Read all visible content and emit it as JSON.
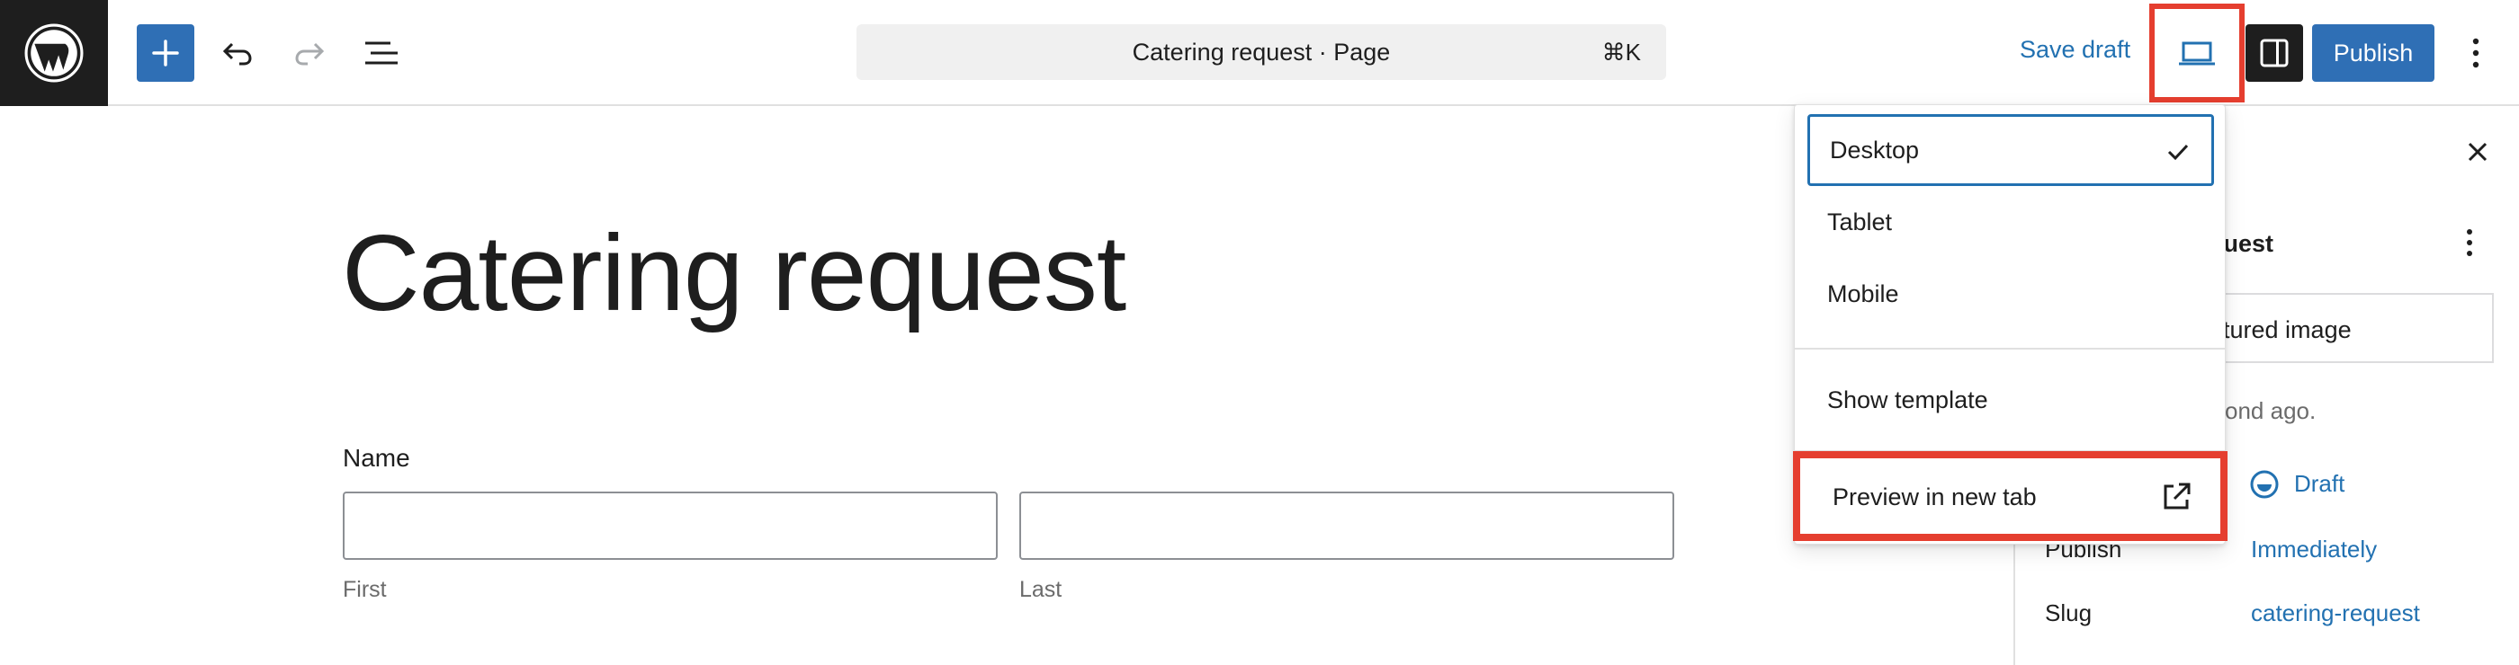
{
  "toolbar": {
    "document_title": "Catering request · Page",
    "shortcut": "⌘K",
    "save_draft_label": "Save draft",
    "publish_label": "Publish"
  },
  "page": {
    "title": "Catering request",
    "name_field_label": "Name",
    "first_sublabel": "First",
    "last_sublabel": "Last"
  },
  "sidebar": {
    "title_fragment": "quest",
    "featured_image_fragment": "atured image",
    "saved_fragment": "cond ago.",
    "status_value": "Draft",
    "publish_label": "Publish",
    "publish_value": "Immediately",
    "slug_label": "Slug",
    "slug_value": "catering-request"
  },
  "view_menu": {
    "items": [
      {
        "label": "Desktop",
        "selected": true
      },
      {
        "label": "Tablet",
        "selected": false
      },
      {
        "label": "Mobile",
        "selected": false
      }
    ],
    "show_template_label": "Show template",
    "preview_label": "Preview in new tab"
  },
  "colors": {
    "accent": "#2f6fb5",
    "link": "#2271b1",
    "highlight": "#e53e2f",
    "dark": "#1e1e1e"
  }
}
